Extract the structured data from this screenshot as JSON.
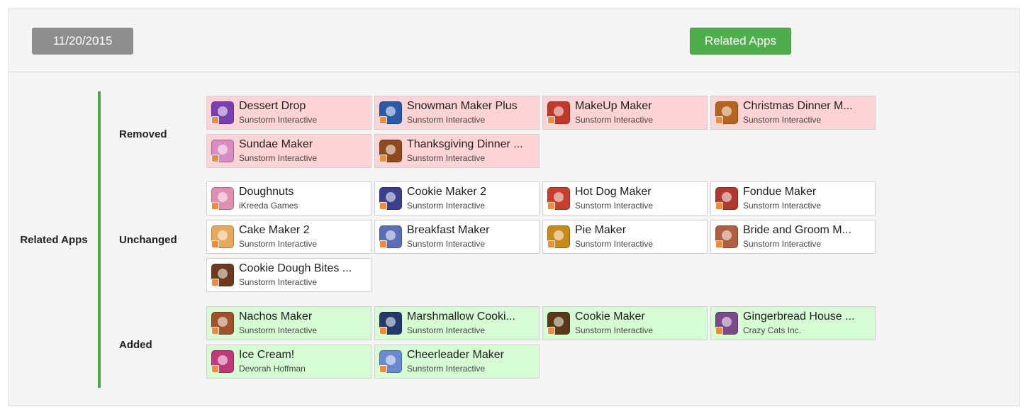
{
  "header": {
    "date_label": "11/20/2015",
    "related_apps_button": "Related Apps"
  },
  "section": {
    "title": "Related Apps",
    "accent_color": "#49a842"
  },
  "groups": {
    "removed": {
      "label": "Removed",
      "color": "#fdd4d6",
      "apps": [
        {
          "name": "Dessert Drop",
          "developer": "Sunstorm Interactive",
          "icon": "dessert-drop-icon"
        },
        {
          "name": "Snowman Maker Plus",
          "developer": "Sunstorm Interactive",
          "icon": "snowman-maker-icon"
        },
        {
          "name": "MakeUp Maker",
          "developer": "Sunstorm Interactive",
          "icon": "makeup-maker-icon"
        },
        {
          "name": "Christmas Dinner M...",
          "developer": "Sunstorm Interactive",
          "icon": "christmas-dinner-icon"
        },
        {
          "name": "Sundae Maker",
          "developer": "Sunstorm Interactive",
          "icon": "sundae-maker-icon"
        },
        {
          "name": "Thanksgiving Dinner ...",
          "developer": "Sunstorm Interactive",
          "icon": "thanksgiving-dinner-icon"
        }
      ]
    },
    "unchanged": {
      "label": "Unchanged",
      "color": "#ffffff",
      "apps": [
        {
          "name": "Doughnuts",
          "developer": "iKreeda Games",
          "icon": "doughnuts-icon"
        },
        {
          "name": "Cookie Maker 2",
          "developer": "Sunstorm Interactive",
          "icon": "cookie-maker-2-icon"
        },
        {
          "name": "Hot Dog Maker",
          "developer": "Sunstorm Interactive",
          "icon": "hot-dog-maker-icon"
        },
        {
          "name": "Fondue Maker",
          "developer": "Sunstorm Interactive",
          "icon": "fondue-maker-icon"
        },
        {
          "name": "Cake Maker 2",
          "developer": "Sunstorm Interactive",
          "icon": "cake-maker-2-icon"
        },
        {
          "name": "Breakfast Maker",
          "developer": "Sunstorm Interactive",
          "icon": "breakfast-maker-icon"
        },
        {
          "name": "Pie Maker",
          "developer": "Sunstorm Interactive",
          "icon": "pie-maker-icon"
        },
        {
          "name": "Bride and Groom M...",
          "developer": "Sunstorm Interactive",
          "icon": "bride-groom-icon"
        },
        {
          "name": "Cookie Dough Bites ...",
          "developer": "Sunstorm Interactive",
          "icon": "cookie-dough-bites-icon"
        }
      ]
    },
    "added": {
      "label": "Added",
      "color": "#d6fcd3",
      "apps": [
        {
          "name": "Nachos Maker",
          "developer": "Sunstorm Interactive",
          "icon": "nachos-maker-icon"
        },
        {
          "name": "Marshmallow Cooki...",
          "developer": "Sunstorm Interactive",
          "icon": "marshmallow-cookie-icon"
        },
        {
          "name": "Cookie Maker",
          "developer": "Sunstorm Interactive",
          "icon": "cookie-maker-icon"
        },
        {
          "name": "Gingerbread House ...",
          "developer": "Crazy Cats Inc.",
          "icon": "gingerbread-house-icon"
        },
        {
          "name": "Ice Cream!",
          "developer": "Devorah Hoffman",
          "icon": "ice-cream-icon"
        },
        {
          "name": "Cheerleader Maker",
          "developer": "Sunstorm Interactive",
          "icon": "cheerleader-maker-icon"
        }
      ]
    }
  }
}
